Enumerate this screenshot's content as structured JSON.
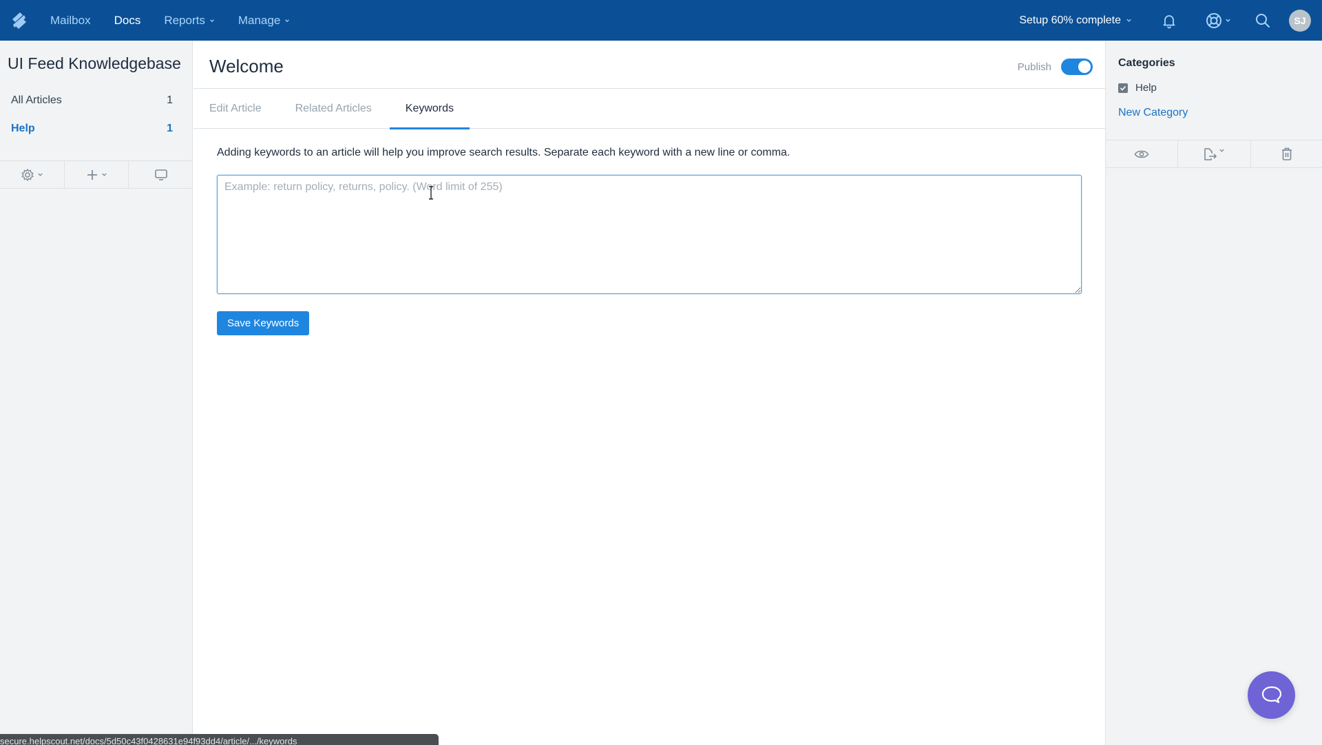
{
  "topnav": {
    "items": [
      {
        "label": "Mailbox",
        "active": false
      },
      {
        "label": "Docs",
        "active": true
      },
      {
        "label": "Reports",
        "active": false,
        "dropdown": true
      },
      {
        "label": "Manage",
        "active": false,
        "dropdown": true
      }
    ],
    "setup_label": "Setup 60% complete",
    "avatar_initials": "SJ",
    "icons": [
      "helpscout-logo-icon",
      "bell-icon",
      "lifebuoy-icon",
      "search-icon"
    ]
  },
  "sidebar": {
    "title": "UI Feed Knowledgebase",
    "items": [
      {
        "label": "All Articles",
        "count": "1",
        "active": false
      },
      {
        "label": "Help",
        "count": "1",
        "active": true
      }
    ],
    "tools": [
      "gear-icon",
      "plus-icon",
      "monitor-icon"
    ]
  },
  "main": {
    "title": "Welcome",
    "publish_label": "Publish",
    "publish_on": true,
    "tabs": [
      {
        "label": "Edit Article",
        "active": false
      },
      {
        "label": "Related Articles",
        "active": false
      },
      {
        "label": "Keywords",
        "active": true
      }
    ],
    "hint": "Adding keywords to an article will help you improve search results. Separate each keyword with a new line or comma.",
    "keywords_value": "",
    "keywords_placeholder": "Example: return policy, returns, policy. (Word limit of 255)",
    "save_label": "Save Keywords"
  },
  "rightbar": {
    "categories_title": "Categories",
    "categories": [
      {
        "label": "Help",
        "checked": true
      }
    ],
    "new_category_label": "New Category",
    "tools": [
      "eye-icon",
      "export-icon",
      "trash-icon"
    ]
  },
  "statusbar": {
    "url": "secure.helpscout.net/docs/5d50c43f0428631e94f93dd4/article/.../keywords"
  },
  "colors": {
    "nav_bg": "#0b5096",
    "accent": "#1f86e0",
    "link": "#1a73c6",
    "beacon": "#6e64d6"
  }
}
